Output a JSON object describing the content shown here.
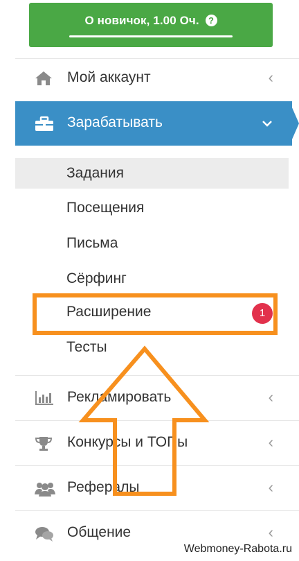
{
  "status": {
    "text": "О новичок, 1.00 Оч.",
    "help_glyph": "?"
  },
  "menu": {
    "account": {
      "label": "Мой аккаунт",
      "icon": "home-icon",
      "chevron": "‹"
    },
    "earn": {
      "label": "Зарабатывать",
      "icon": "briefcase-icon",
      "chevron": "⌄"
    },
    "earn_submenu": [
      {
        "label": "Задания"
      },
      {
        "label": "Посещения"
      },
      {
        "label": "Письма"
      },
      {
        "label": "Сёрфинг"
      },
      {
        "label": "Расширение",
        "badge": "1"
      },
      {
        "label": "Тесты"
      }
    ],
    "advertise": {
      "label": "Рекламировать",
      "icon": "bar-chart-icon",
      "chevron": "‹"
    },
    "contests": {
      "label": "Конкурсы и ТОПы",
      "icon": "trophy-icon",
      "chevron": "‹"
    },
    "referrals": {
      "label": "Рефералы",
      "icon": "users-icon",
      "chevron": "‹"
    },
    "chat": {
      "label": "Общение",
      "icon": "comments-icon",
      "chevron": "‹"
    }
  },
  "watermark": "Webmoney-Rabota.ru",
  "colors": {
    "status_green": "#4aa845",
    "active_blue": "#3a8fc6",
    "badge_red": "#e2314c",
    "annotation_orange": "#f7901e"
  }
}
